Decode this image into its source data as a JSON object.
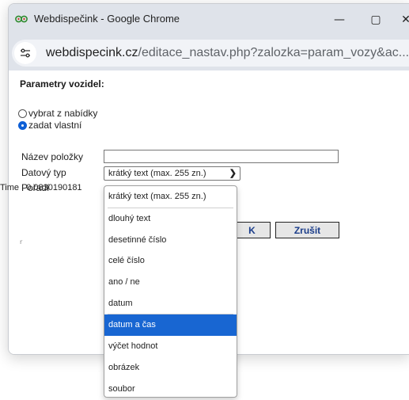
{
  "window": {
    "title": "Webdispečink - Google Chrome",
    "url_domain": "webdispecink.cz",
    "url_path": "/editace_nastav.php?zalozka=param_vozy&ac...",
    "minimize_symbol": "—",
    "maximize_symbol": "▢",
    "close_symbol": "✕"
  },
  "page": {
    "heading": "Parametry vozidel:",
    "radio_option_1": "vybrat z nabídky",
    "radio_option_2": "zadat vlastní",
    "label_name": "Název položky",
    "label_type": "Datový typ",
    "label_order": "Pořadí",
    "name_value": "",
    "selected_type": "krátký text (max. 255 zn.)",
    "ok_button": "K",
    "cancel_button": "Zrušit",
    "small_mark": "r",
    "time_text": "Time : 0.0830190181"
  },
  "dropdown": {
    "options": [
      "krátký text (max. 255 zn.)",
      "dlouhý text",
      "desetinné číslo",
      "celé číslo",
      "ano / ne",
      "datum",
      "datum a čas",
      "výčet hodnot",
      "obrázek",
      "soubor"
    ],
    "highlighted_index": 6
  },
  "colors": {
    "highlight": "#1866d2",
    "radio_checked": "#0d5fd6",
    "button_text": "#1b3d8a"
  }
}
